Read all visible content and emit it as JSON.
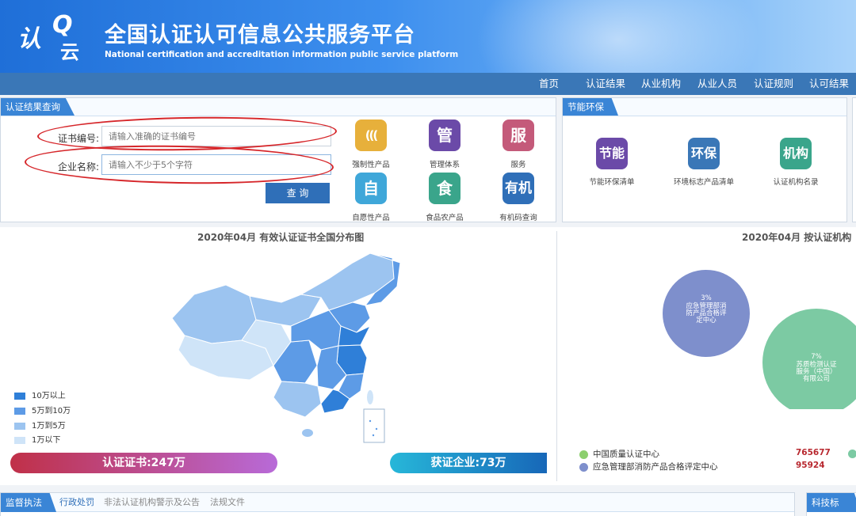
{
  "header": {
    "logo": {
      "part1": "认",
      "part2": "Q",
      "part3": "云"
    },
    "title": "全国认证认可信息公共服务平台",
    "subtitle": "National certification and accreditation information public service platform"
  },
  "nav": {
    "items": [
      "首页",
      "认证结果",
      "从业机构",
      "从业人员",
      "认证规则",
      "认可结果"
    ]
  },
  "query_panel": {
    "tab": "认证结果查询",
    "cert_label": "证书编号:",
    "cert_placeholder": "请输入准确的证书编号",
    "company_label": "企业名称:",
    "company_placeholder": "请输入不少于5个字符",
    "query_button": "查 询",
    "tiles": [
      {
        "glyph": "(((",
        "label": "强制性产品",
        "color": "#e7b03b"
      },
      {
        "glyph": "管",
        "label": "管理体系",
        "color": "#6b4aa8"
      },
      {
        "glyph": "服",
        "label": "服务",
        "color": "#c45a7a"
      },
      {
        "glyph": "自",
        "label": "自愿性产品",
        "color": "#3fa7d9"
      },
      {
        "glyph": "食",
        "label": "食品农产品",
        "color": "#3aa58b"
      },
      {
        "glyph": "有机",
        "label": "有机码查询",
        "color": "#2f6fb8"
      }
    ]
  },
  "energy_panel": {
    "tab": "节能环保",
    "tiles": [
      {
        "glyph": "节能",
        "label": "节能环保清单",
        "color": "#6b4aa8"
      },
      {
        "glyph": "环保",
        "label": "环境标志产品清单",
        "color": "#3a77b7"
      },
      {
        "glyph": "机构",
        "label": "认证机构名录",
        "color": "#3aa58b"
      }
    ]
  },
  "map_section": {
    "title": "2020年04月  有效认证证书全国分布图",
    "legend": [
      {
        "label": "10万以上",
        "color": "#2f7fd8"
      },
      {
        "label": "5万到10万",
        "color": "#5d9be6"
      },
      {
        "label": "1万到5万",
        "color": "#9cc4f0"
      },
      {
        "label": "1万以下",
        "color": "#cfe4f8"
      }
    ],
    "cert_bar": "认证证书:247万",
    "company_bar": "获证企业:73万"
  },
  "org_section": {
    "title": "2020年04月  按认证机构",
    "bubbles": [
      {
        "pct": "3%",
        "name_lines": [
          "应急管理部消",
          "防产品合格评",
          "定中心"
        ],
        "color": "#7e8fcc"
      },
      {
        "pct": "7%",
        "name_lines": [
          "苏质检测认证",
          "服务（中国）",
          "有限公司"
        ],
        "color": "#7ccaa3"
      }
    ],
    "legend": [
      {
        "label": "中国质量认证中心",
        "value": "765677",
        "color": "#8ccf6e"
      },
      {
        "label": "应急管理部消防产品合格评定中心",
        "value": "95924",
        "color": "#7e8fcc"
      }
    ]
  },
  "bottom": {
    "tab": "监督执法",
    "links": [
      "行政处罚",
      "非法认证机构警示及公告",
      "法规文件"
    ],
    "right_tab": "科技标准"
  }
}
